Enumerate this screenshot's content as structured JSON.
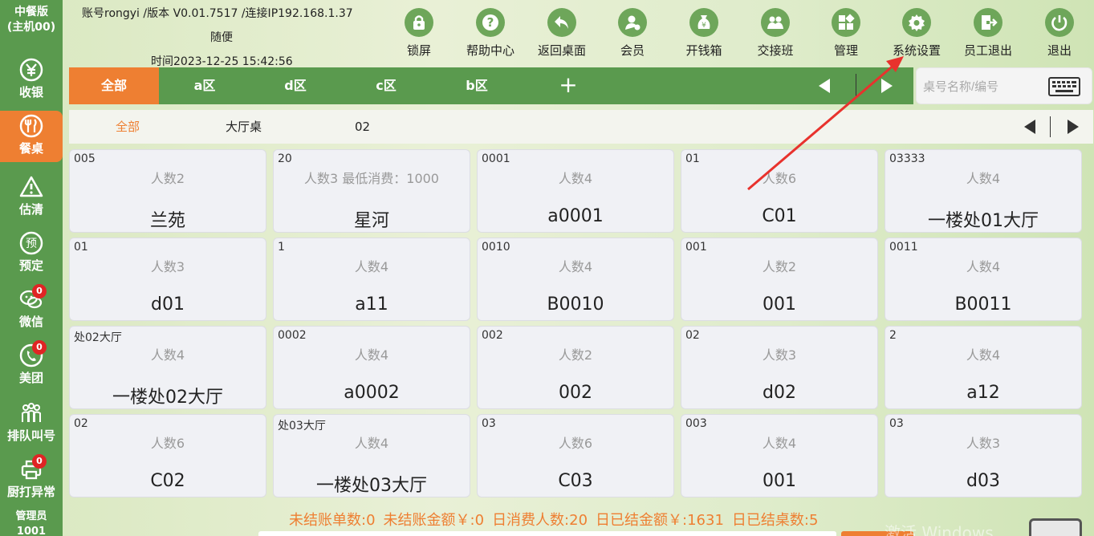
{
  "sidebar": {
    "edition_line1": "中餐版",
    "edition_line2": "(主机00)",
    "items": [
      {
        "label": "收银",
        "icon": "yen-icon",
        "badge": null
      },
      {
        "label": "餐桌",
        "icon": "cutlery-icon",
        "badge": null,
        "active": true
      },
      {
        "label": "估清",
        "icon": "warning-icon",
        "badge": null
      },
      {
        "label": "预定",
        "icon": "reserve-icon",
        "badge": null
      },
      {
        "label": "微信",
        "icon": "wechat-icon",
        "badge": "0"
      },
      {
        "label": "美团",
        "icon": "phone-icon",
        "badge": "0"
      },
      {
        "label": "排队叫号",
        "icon": "queue-icon",
        "badge": null
      },
      {
        "label": "厨打异常",
        "icon": "printer-icon",
        "badge": "0"
      }
    ],
    "admin_line1": "管理员",
    "admin_line2": "1001"
  },
  "header": {
    "line1": "账号rongyi /版本 V0.01.7517 /连接IP192.168.1.37",
    "line2": "随便",
    "line3": "时间2023-12-25 15:42:56"
  },
  "toolbar": [
    {
      "label": "锁屏",
      "icon": "lock-icon"
    },
    {
      "label": "帮助中心",
      "icon": "help-icon"
    },
    {
      "label": "返回桌面",
      "icon": "back-icon"
    },
    {
      "label": "会员",
      "icon": "member-icon"
    },
    {
      "label": "开钱箱",
      "icon": "cashbox-icon"
    },
    {
      "label": "交接班",
      "icon": "shift-icon"
    },
    {
      "label": "管理",
      "icon": "manage-icon"
    },
    {
      "label": "系统设置",
      "icon": "gear-icon"
    },
    {
      "label": "员工退出",
      "icon": "logout-icon"
    },
    {
      "label": "退出",
      "icon": "power-icon"
    }
  ],
  "area_tabs": [
    "全部",
    "a区",
    "d区",
    "c区",
    "b区"
  ],
  "search": {
    "placeholder": "桌号名称/编号",
    "value": ""
  },
  "sub_tabs": [
    "全部",
    "大厅桌",
    "02"
  ],
  "tables": [
    {
      "code": "005",
      "guests": "人数2",
      "name": "兰苑"
    },
    {
      "code": "20",
      "guests": "人数3 最低消费：1000",
      "name": "星河"
    },
    {
      "code": "0001",
      "guests": "人数4",
      "name": "a0001"
    },
    {
      "code": "01",
      "guests": "人数6",
      "name": "C01"
    },
    {
      "code": "03333",
      "guests": "人数4",
      "name": "一楼处01大厅"
    },
    {
      "code": "01",
      "guests": "人数3",
      "name": "d01"
    },
    {
      "code": "1",
      "guests": "人数4",
      "name": "a11"
    },
    {
      "code": "0010",
      "guests": "人数4",
      "name": "B0010"
    },
    {
      "code": "001",
      "guests": "人数2",
      "name": "001"
    },
    {
      "code": "0011",
      "guests": "人数4",
      "name": "B0011"
    },
    {
      "code": "处02大厅",
      "guests": "人数4",
      "name": "一楼处02大厅"
    },
    {
      "code": "0002",
      "guests": "人数4",
      "name": "a0002"
    },
    {
      "code": "002",
      "guests": "人数2",
      "name": "002"
    },
    {
      "code": "02",
      "guests": "人数3",
      "name": "d02"
    },
    {
      "code": "2",
      "guests": "人数4",
      "name": "a12"
    },
    {
      "code": "02",
      "guests": "人数6",
      "name": "C02"
    },
    {
      "code": "处03大厅",
      "guests": "人数4",
      "name": "一楼处03大厅"
    },
    {
      "code": "03",
      "guests": "人数6",
      "name": "C03"
    },
    {
      "code": "003",
      "guests": "人数4",
      "name": "001"
    },
    {
      "code": "03",
      "guests": "人数3",
      "name": "d03"
    }
  ],
  "footer": {
    "unsettled_orders": "未结账单数:0",
    "unsettled_amount": "未结账金额￥:0",
    "daily_guests": "日消费人数:20",
    "settled_amount": "日已结金额￥:1631",
    "settled_tables": "日已结桌数:5",
    "watermark": "激活 Windows"
  },
  "colors": {
    "accent": "#ee7f32",
    "brand_green": "#5a9a4e",
    "badge_red": "#e02424",
    "annotation_red": "#e8322d"
  }
}
